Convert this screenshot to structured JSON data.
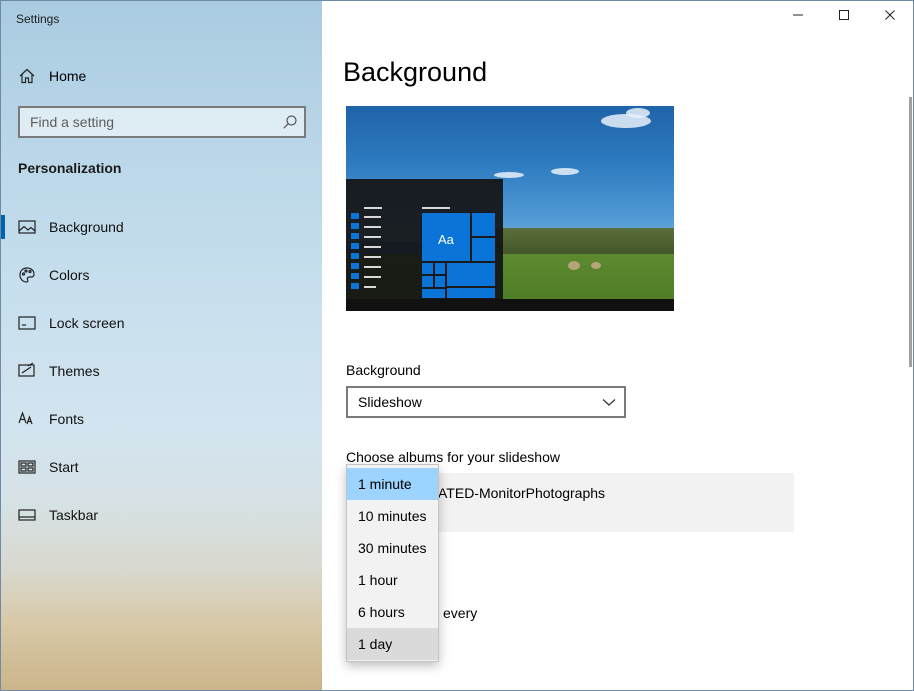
{
  "window": {
    "title": "Settings"
  },
  "sidebar": {
    "home_label": "Home",
    "search_placeholder": "Find a setting",
    "section_title": "Personalization",
    "items": [
      {
        "label": "Background",
        "icon": "picture-icon",
        "active": true
      },
      {
        "label": "Colors",
        "icon": "palette-icon"
      },
      {
        "label": "Lock screen",
        "icon": "lock-screen-icon"
      },
      {
        "label": "Themes",
        "icon": "themes-icon"
      },
      {
        "label": "Fonts",
        "icon": "fonts-icon"
      },
      {
        "label": "Start",
        "icon": "start-icon"
      },
      {
        "label": "Taskbar",
        "icon": "taskbar-icon"
      }
    ]
  },
  "main": {
    "title": "Background",
    "preview_tile_text": "Aa",
    "background_label": "Background",
    "background_value": "Slideshow",
    "albums_label": "Choose albums for your slideshow",
    "album_name": "ATED-MonitorPhotographs",
    "change_label": "every"
  },
  "flyout": {
    "options": [
      "1 minute",
      "10 minutes",
      "30 minutes",
      "1 hour",
      "6 hours",
      "1 day"
    ],
    "selected": "1 minute",
    "hovered": "1 day"
  },
  "colors": {
    "accent": "#0063b1",
    "selection": "#9cd4ff",
    "tile_blue": "#0a74d9"
  }
}
